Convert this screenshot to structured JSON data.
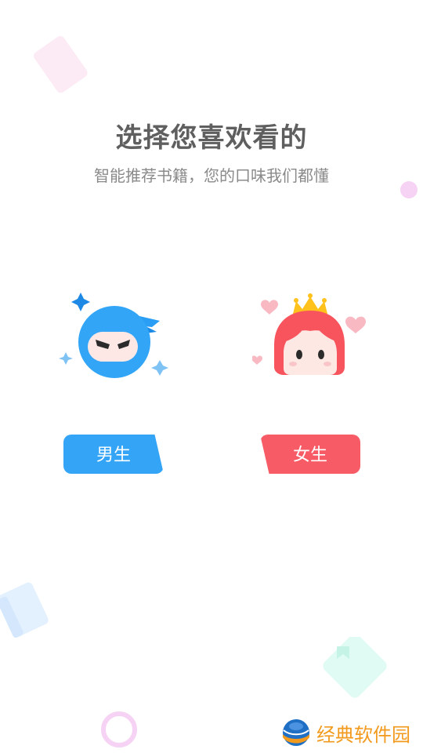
{
  "header": {
    "title": "选择您喜欢看的",
    "subtitle": "智能推荐书籍，您的口味我们都懂"
  },
  "gender_options": {
    "male_label": "男生",
    "female_label": "女生"
  },
  "watermark": {
    "text": "经典软件园",
    "icon": "globe-logo-icon"
  },
  "colors": {
    "male_accent": "#33a4f6",
    "female_accent": "#f75b66",
    "title": "#5f5f5f",
    "subtitle": "#8a8a8a",
    "watermark": "#f29a1d"
  }
}
